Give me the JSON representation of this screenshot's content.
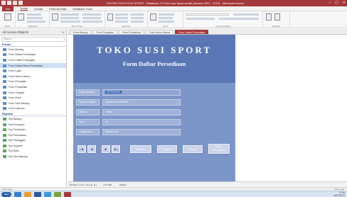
{
  "window": {
    "title": "SISTEM TOKO SUSI SPORT : Database- D:\\Toko Susi Sport.accdb (Access 2007 - 2010) - Microsoft Access",
    "minimize": "–",
    "maximize": "▢",
    "close": "✕"
  },
  "ribbon_tabs": [
    "File",
    "Home",
    "Create",
    "External Data",
    "Database Tools"
  ],
  "ribbon_groups": [
    "Views",
    "Clipboard",
    "Sort & Filter",
    "Records",
    "Find",
    "Text Formatting",
    "Window"
  ],
  "nav": {
    "header": "All Access Objects",
    "search_placeholder": "Search...",
    "forms_header": "Forms",
    "forms": [
      "Form Barang",
      "Form Daftar Persediaan",
      "Form Daftar Pelanggan",
      "Form Daftar Menu Persediaan",
      "Form Login",
      "Form Menu Utama",
      "Form Penjualan",
      "Form Pembelian",
      "Form Supplier",
      "Form Retur",
      "Form Stok Barang",
      "Form Laporan"
    ],
    "reports_header": "Reports",
    "reports": [
      "Rpt Barang",
      "Rpt Penjualan",
      "Rpt Pembelian",
      "Rpt Persediaan",
      "Rpt Pelanggan",
      "Rpt Supplier",
      "Rpt Retur",
      "Rpt Stok Barang"
    ]
  },
  "doc_tabs": [
    "Form Barang",
    "Form Penjualan",
    "Form Pembelian",
    "Form Menu Utama",
    "Form Daftar Persediaan"
  ],
  "form": {
    "shop_name": "TOKO SUSI SPORT",
    "title": "Form Daftar Persediaan",
    "fields": [
      {
        "label": "Kode Sepatu",
        "value": "SPT001/01"
      },
      {
        "label": "Nama Sepatu",
        "value": "Adidas Lili All Black"
      },
      {
        "label": "Warna",
        "value": "Hitam"
      },
      {
        "label": "Size",
        "value": "40"
      },
      {
        "label": "Harga Beli",
        "value": "Rp450.000"
      }
    ],
    "buttons": {
      "first": "|◄",
      "prev": "◄",
      "next": "►",
      "last": "►|",
      "add": "Tambah",
      "delete": "Hapus",
      "save": "Simpan",
      "list_line1": "Daftar",
      "list_line2": "Persediaan"
    }
  },
  "record_nav": {
    "record_label": "Record: 14 ◄ 1 of 8 ► ►|",
    "filter": "No Filter",
    "search": "Search"
  },
  "status": {
    "left": "Form View",
    "right": "Num Lock"
  },
  "taskbar": {
    "start": "Start",
    "time": "17:45",
    "date": "02/01/2024"
  },
  "colors": {
    "access_red": "#a4373a",
    "form_header": "#5a76b5",
    "form_detail": "#7d96c9"
  }
}
